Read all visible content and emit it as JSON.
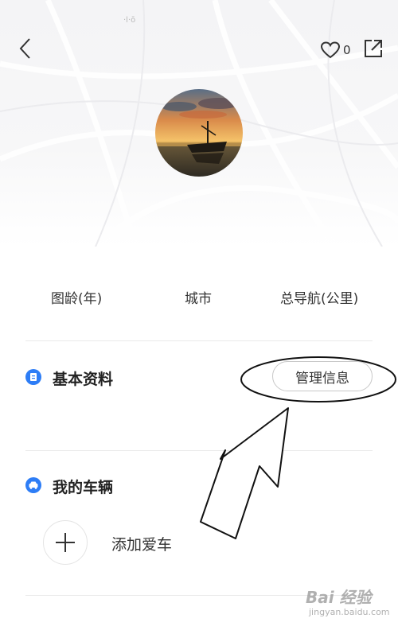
{
  "status_bar": {
    "fragment": "·l·ō"
  },
  "header": {
    "like_count": "0",
    "back_icon": "chevron-left-icon",
    "like_icon": "heart-outline-icon",
    "share_icon": "share-external-icon"
  },
  "profile": {
    "avatar": "sunset-boat-photo"
  },
  "stats": {
    "labels": [
      "图龄(年)",
      "城市",
      "总导航(公里)"
    ]
  },
  "basic_info": {
    "title": "基本资料",
    "manage_button": "管理信息",
    "icon": "document-icon"
  },
  "vehicles": {
    "title": "我的车辆",
    "add_label": "添加爱车",
    "icon": "car-icon",
    "add_icon": "plus-icon"
  },
  "watermark": {
    "main": "Bai 经验",
    "sub": "jingyan.baidu.com"
  },
  "colors": {
    "accent": "#2d7df6",
    "background": "#ffffff",
    "divider": "#eaeaea"
  }
}
